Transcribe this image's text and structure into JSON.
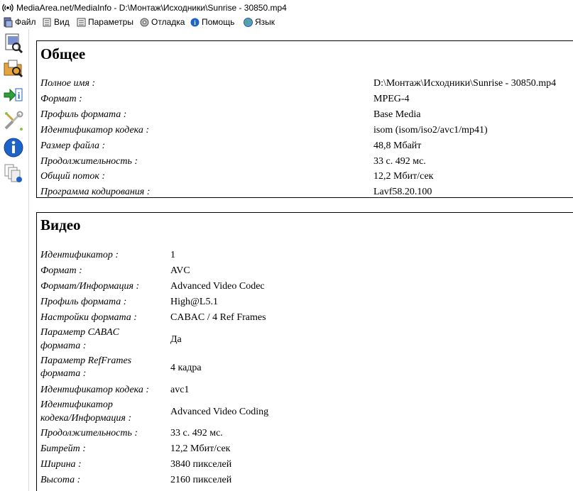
{
  "window": {
    "title": "MediaArea.net/MediaInfo - D:\\Монтаж\\Исходники\\Sunrise - 30850.mp4"
  },
  "menu": {
    "items": [
      {
        "label": "Файл",
        "icon": "file-icon"
      },
      {
        "label": "Вид",
        "icon": "view-icon"
      },
      {
        "label": "Параметры",
        "icon": "options-icon"
      },
      {
        "label": "Отладка",
        "icon": "debug-icon"
      },
      {
        "label": "Помощь",
        "icon": "help-icon"
      },
      {
        "label": "Язык",
        "icon": "language-icon"
      }
    ]
  },
  "sidebar": {
    "buttons": [
      "open-file-icon",
      "open-folder-icon",
      "export-icon",
      "preferences-icon",
      "about-icon",
      "view-mode-icon"
    ]
  },
  "general": {
    "heading": "Общее",
    "rows": [
      {
        "label": "Полное имя :",
        "value": "D:\\Монтаж\\Исходники\\Sunrise - 30850.mp4"
      },
      {
        "label": "Формат :",
        "value": "MPEG-4"
      },
      {
        "label": "Профиль формата :",
        "value": "Base Media"
      },
      {
        "label": "Идентификатор кодека :",
        "value": "isom (isom/iso2/avc1/mp41)"
      },
      {
        "label": "Размер файла :",
        "value": "48,8 Мбайт"
      },
      {
        "label": "Продолжительность :",
        "value": "33 с. 492 мс."
      },
      {
        "label": "Общий поток :",
        "value": "12,2 Мбит/сек"
      },
      {
        "label": "Программа кодирования :",
        "value": "Lavf58.20.100"
      }
    ]
  },
  "video": {
    "heading": "Видео",
    "rows": [
      {
        "label": "Идентификатор :",
        "value": "1"
      },
      {
        "label": "Формат :",
        "value": "AVC"
      },
      {
        "label": "Формат/Информация :",
        "value": "Advanced Video Codec"
      },
      {
        "label": "Профиль формата :",
        "value": "High@L5.1"
      },
      {
        "label": "Настройки формата :",
        "value": "CABAC / 4 Ref Frames"
      },
      {
        "label_line1": "Параметр CABAC",
        "label_line2": "формата :",
        "value": "Да"
      },
      {
        "label_line1": "Параметр RefFrames",
        "label_line2": "формата :",
        "value": "4 кадра"
      },
      {
        "label": "Идентификатор кодека :",
        "value": "avc1"
      },
      {
        "label_line1": "Идентификатор",
        "label_line2": "кодека/Информация :",
        "value": "Advanced Video Coding"
      },
      {
        "label": "Продолжительность :",
        "value": "33 с. 492 мс."
      },
      {
        "label": "Битрейт :",
        "value": "12,2 Мбит/сек"
      },
      {
        "label": "Ширина :",
        "value": "3840 пикселей"
      },
      {
        "label": "Высота :",
        "value": "2160 пикселей"
      }
    ]
  }
}
